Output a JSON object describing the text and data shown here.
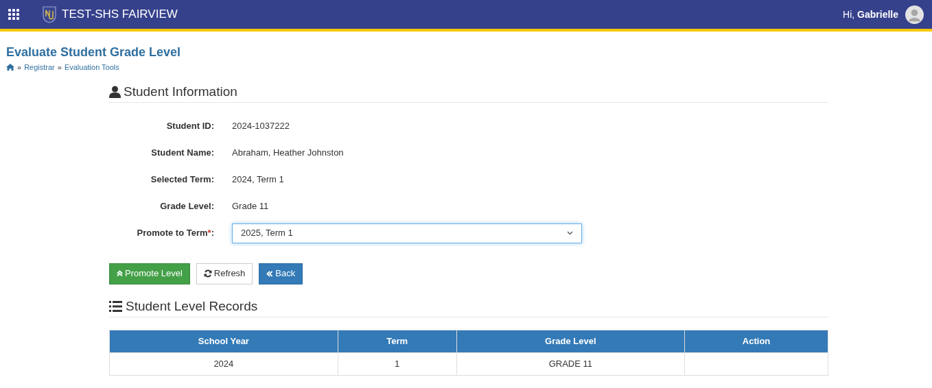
{
  "header": {
    "title": "TEST-SHS FAIRVIEW",
    "greeting": "Hi,",
    "user": "Gabrielle"
  },
  "page": {
    "title": "Evaluate Student Grade Level",
    "breadcrumb": [
      "Registrar",
      "Evaluation Tools"
    ],
    "separator": "»"
  },
  "student_info": {
    "heading": "Student Information",
    "fields": [
      {
        "label": "Student ID:",
        "value": "2024-1037222"
      },
      {
        "label": "Student Name:",
        "value": "Abraham, Heather Johnston"
      },
      {
        "label": "Selected Term:",
        "value": "2024, Term 1"
      },
      {
        "label": "Grade Level:",
        "value": "Grade 11"
      }
    ],
    "promote": {
      "label": "Promote to Term",
      "required_mark": "*",
      "suffix": ":",
      "value": "2025, Term 1",
      "focused": true
    }
  },
  "buttons": [
    {
      "kind": "promote",
      "label": "Promote Level"
    },
    {
      "kind": "refresh",
      "label": "Refresh"
    },
    {
      "kind": "back",
      "label": "Back"
    }
  ],
  "records": {
    "heading": "Student Level Records",
    "columns": [
      "School Year",
      "Term",
      "Grade Level",
      "Action"
    ],
    "rows": [
      [
        "2024",
        "1",
        "GRADE 11",
        ""
      ]
    ]
  }
}
